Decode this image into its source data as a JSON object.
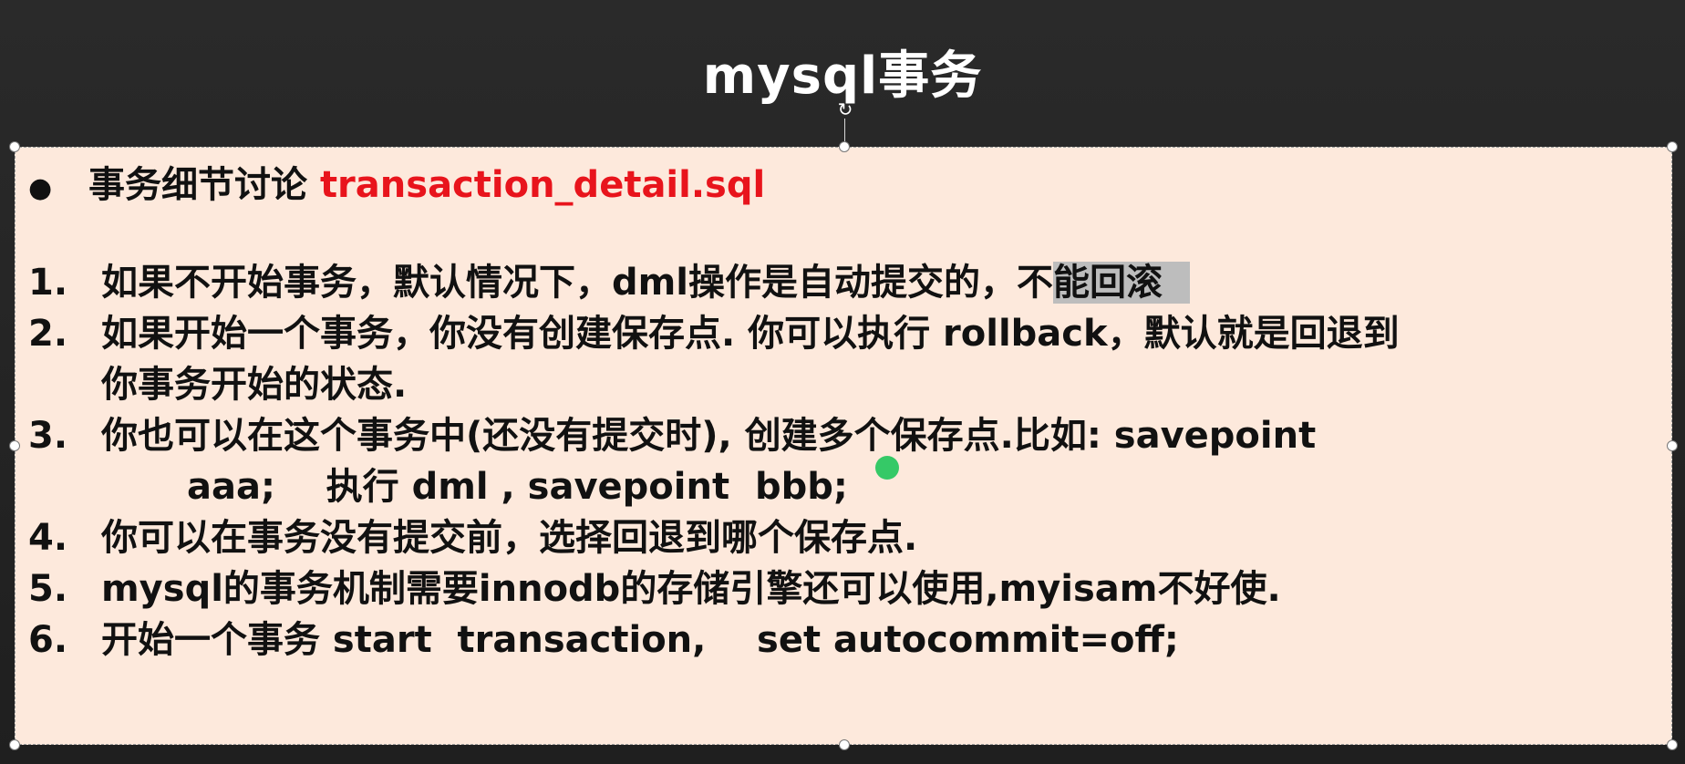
{
  "title": "mysql事务",
  "bullet": {
    "label": "事务细节讨论 ",
    "file": "transaction_detail.sql"
  },
  "items": [
    {
      "num": "1.",
      "text_a": "如果不开始事务，默认情况下，dml操作是自动提交的，不",
      "text_b": "能回滚"
    },
    {
      "num": "2.",
      "text": "如果开始一个事务，你没有创建保存点. 你可以执行 rollback，默认就是回退到",
      "cont": "你事务开始的状态."
    },
    {
      "num": "3.",
      "text": "你也可以在这个事务中(还没有提交时), 创建多个保存点.比如: savepoint",
      "cont": "aaa;    执行 dml , savepoint  bbb;"
    },
    {
      "num": "4.",
      "text": "你可以在事务没有提交前，选择回退到哪个保存点."
    },
    {
      "num": "5.",
      "text": "mysql的事务机制需要innodb的存储引擎还可以使用,myisam不好使."
    },
    {
      "num": "6.",
      "text": "开始一个事务 start  transaction,    set autocommit=off;"
    }
  ]
}
